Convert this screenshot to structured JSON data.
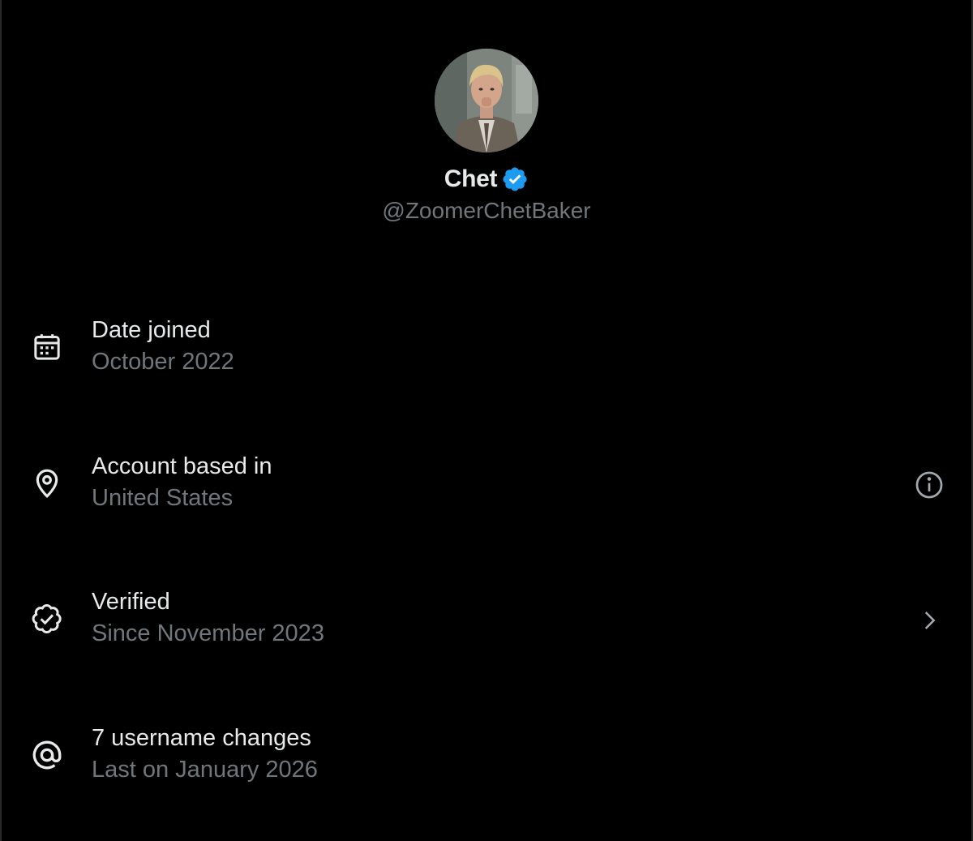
{
  "profile": {
    "display_name": "Chet",
    "handle": "@ZoomerChetBaker",
    "verified": true,
    "avatar_icon": "avatar-photo"
  },
  "rows": [
    {
      "icon": "calendar-icon",
      "title": "Date joined",
      "subtitle": "October 2022"
    },
    {
      "icon": "location-pin-icon",
      "title": "Account based in",
      "subtitle": "United States",
      "action_icon": "info-icon"
    },
    {
      "icon": "verified-badge-icon",
      "title": "Verified",
      "subtitle": "Since November 2023",
      "action_icon": "chevron-right-icon"
    },
    {
      "icon": "at-sign-icon",
      "title": "7 username changes",
      "subtitle": "Last on January 2026"
    }
  ],
  "colors": {
    "background": "#000000",
    "primary_text": "#e7e9ea",
    "secondary_text": "#71767b",
    "verified_blue": "#1d9bf0"
  }
}
